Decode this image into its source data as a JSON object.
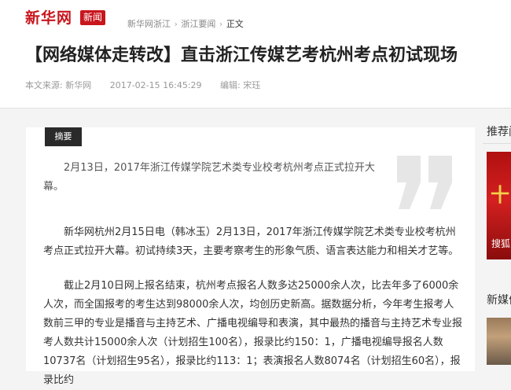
{
  "header": {
    "logo_text": "新华网",
    "logo_tag": "新闻",
    "breadcrumb": [
      "新华网浙江",
      "浙江要闻",
      "正文"
    ],
    "breadcrumb_sep": "›"
  },
  "article": {
    "title": "【网络媒体走转改】直击浙江传媒艺考杭州考点初试现场",
    "source": "本文来源:  新华网",
    "datetime": "2017-02-15 16:45:29",
    "editor": "编辑: 宋珏",
    "abstract_label": "摘要",
    "abstract": "2月13日，2017年浙江传媒学院艺术类专业校考杭州考点正式拉开大幕。",
    "paragraphs": [
      "新华网杭州2月15日电（韩冰玉）2月13日，2017年浙江传媒学院艺术类专业校考杭州考点正式拉开大幕。初试持续3天，主要考察考生的形象气质、语言表达能力和相关才艺等。",
      "截止2月10日网上报名结束，杭州考点报名人数多达25000余人次，比去年多了6000余人次，而全国报考的考生达到98000余人次，均创历史新高。据数据分析，今年考生报考人数前三甲的专业是播音与主持艺术、广播电视编导和表演，其中最热的播音与主持艺术专业报考人数共计15000余人次（计划招生100名），报录比约150：1，广播电视编导报名人数10737名（计划招生95名），报录比约113：1；表演报名人数8074名（计划招生60名），报录比约"
    ]
  },
  "sidebar": {
    "section1_title": "推荐阅读",
    "section1_glyph": "十",
    "section1_caption": "搜狐",
    "section2_title": "新媒体"
  },
  "colors": {
    "brand_red": "#c8161d",
    "abstract_tag_bg": "#2a2a2a"
  }
}
